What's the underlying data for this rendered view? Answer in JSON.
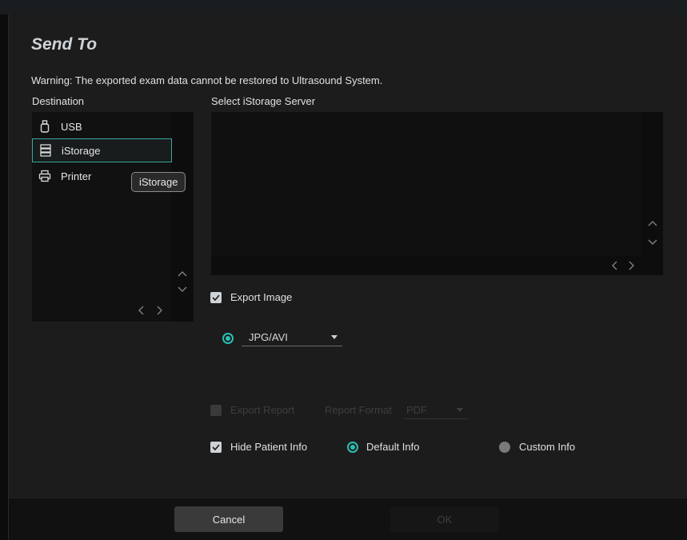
{
  "dialog": {
    "title": "Send To",
    "warning": "Warning: The exported exam data cannot be restored to Ultrasound System."
  },
  "destination": {
    "label": "Destination",
    "items": [
      {
        "label": "USB",
        "icon": "usb-icon"
      },
      {
        "label": "iStorage",
        "icon": "server-icon"
      },
      {
        "label": "Printer",
        "icon": "printer-icon"
      }
    ],
    "selected": "iStorage",
    "tooltip": "iStorage"
  },
  "server": {
    "label": "Select iStorage Server"
  },
  "export_image": {
    "label": "Export Image",
    "checked": true,
    "format_selected": "JPG/AVI"
  },
  "export_report": {
    "label": "Export Report",
    "checked": false,
    "enabled": false,
    "format_label": "Report Format",
    "format_selected": "PDF"
  },
  "hide_patient": {
    "label": "Hide Patient Info",
    "checked": true,
    "options": [
      {
        "label": "Default Info",
        "selected": true
      },
      {
        "label": "Custom Info",
        "selected": false
      }
    ]
  },
  "footer": {
    "cancel_label": "Cancel",
    "ok_label": "OK"
  },
  "colors": {
    "accent": "#2bc0b4",
    "dialog_bg": "#1c1c1c",
    "panel_bg": "#111111"
  }
}
